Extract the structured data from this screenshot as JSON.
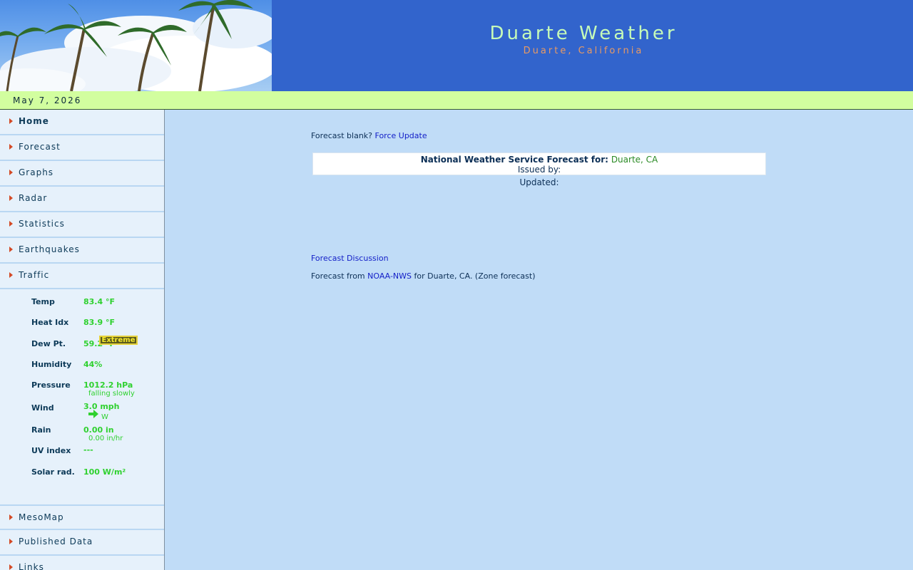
{
  "header": {
    "title": "Duarte Weather",
    "subtitle": "Duarte, California"
  },
  "date": "May 7, 2026",
  "sidebar": {
    "nav_top": [
      {
        "label": "Home",
        "active": true
      },
      {
        "label": "Forecast"
      },
      {
        "label": "Graphs"
      },
      {
        "label": "Radar"
      },
      {
        "label": "Statistics"
      },
      {
        "label": "Earthquakes"
      },
      {
        "label": "Traffic"
      }
    ],
    "nav_bottom": [
      {
        "label": "MesoMap"
      },
      {
        "label": "Published Data"
      },
      {
        "label": "Links"
      }
    ],
    "weather": {
      "temp_label": "Temp",
      "temp_value": "83.4 °F",
      "heat_label": "Heat Idx",
      "heat_value": "83.9 °F",
      "dew_label": "Dew Pt.",
      "dew_value": "59.2 °F",
      "humidity_label": "Humidity",
      "humidity_value": "44%",
      "pressure_label": "Pressure",
      "pressure_value": "1012.2 hPa",
      "pressure_trend": "falling slowly",
      "wind_label": "Wind",
      "wind_value": "3.0 mph",
      "wind_dir": "W",
      "rain_label": "Rain",
      "rain_value": "0.00 in",
      "rain_rate": "0.00 in/hr",
      "uv_label": "UV index",
      "uv_value": "---",
      "uv_badge": "Extreme",
      "solar_label": "Solar rad.",
      "solar_value": "100 W/m²"
    }
  },
  "main": {
    "blank_text": "Forecast blank?",
    "force_update": "Force Update",
    "nws_title": "National Weather Service Forecast for:",
    "nws_location": "Duarte, CA",
    "issued_by": "Issued by:",
    "updated": "Updated:",
    "discussion_link": "Forecast Discussion",
    "forecast_from": "Forecast from",
    "noaa_link": "NOAA-NWS",
    "forecast_suffix": "for Duarte, CA. (Zone forecast)"
  },
  "colors": {
    "header_bg": "#3264cc",
    "title": "#c6fbb8",
    "subtitle": "#e99a63",
    "datebar": "#d2fe9f",
    "content_bg": "#c0dcf7",
    "value_green": "#2fd12f"
  }
}
